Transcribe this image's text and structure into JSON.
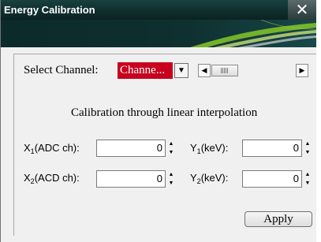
{
  "window": {
    "title": "Energy Calibration"
  },
  "channel": {
    "label": "Select Channel:",
    "selected": "Channe..."
  },
  "section": {
    "heading": "Calibration through linear interpolation"
  },
  "x1": {
    "prefix": "X",
    "sub": "1",
    "suffix": "(ADC ch):",
    "value": "0"
  },
  "x2": {
    "prefix": "X",
    "sub": "2",
    "suffix": "(ACD ch):",
    "value": "0"
  },
  "y1": {
    "prefix": "Y",
    "sub": "1",
    "suffix": "(keV):",
    "value": "0"
  },
  "y2": {
    "prefix": "Y",
    "sub": "2",
    "suffix": "(keV):",
    "value": "0"
  },
  "apply": {
    "label": "Apply"
  },
  "colors": {
    "title_bar": "#0f2e2e",
    "channel_field": "#c8001e",
    "banner_accent": "#7fbf2a"
  },
  "icons": {
    "close": "close-icon",
    "dropdown": "chevron-down-icon",
    "scroll_left": "arrow-left-icon",
    "scroll_right": "arrow-right-icon"
  }
}
